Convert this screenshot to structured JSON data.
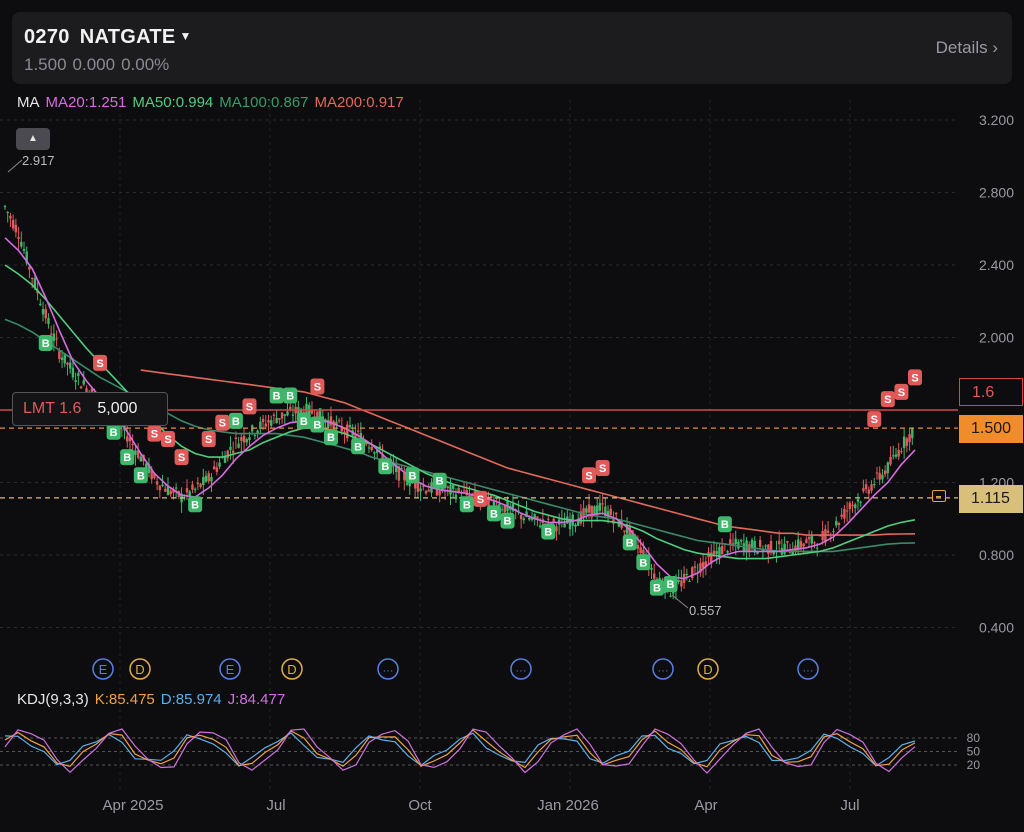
{
  "header": {
    "code": "0270",
    "name": "NATGATE",
    "price": "1.500",
    "change": "0.000",
    "change_pct": "0.00%",
    "details_label": "Details ›"
  },
  "ma_legend": {
    "title": "MA",
    "ma20": "MA20:1.251",
    "ma50": "MA50:0.994",
    "ma100": "MA100:0.867",
    "ma200": "MA200:0.917"
  },
  "kdj_legend": {
    "title": "KDJ(9,3,3)",
    "k": "K:85.475",
    "d": "D:85.974",
    "j": "J:84.477"
  },
  "y_axis_ticks": [
    "3.200",
    "2.800",
    "2.400",
    "2.000",
    "1.200",
    "0.800",
    "0.400"
  ],
  "x_axis_ticks": [
    "Apr 2025",
    "Jul",
    "Oct",
    "Jan 2026",
    "Apr",
    "Jul"
  ],
  "kdj_levels": [
    "80",
    "50",
    "20"
  ],
  "order_line": {
    "type": "LMT 1.6",
    "qty": "5,000",
    "price_tag": "1.6"
  },
  "last_price_tag": "1.500",
  "prev_price_tag": "1.115",
  "high_label": "2.917",
  "low_label": "0.557",
  "event_markers": [
    "E",
    "D",
    "E",
    "D",
    "···",
    "···",
    "···",
    "D",
    "···"
  ],
  "signal_labels": {
    "buy": "B",
    "sell": "S"
  },
  "colors": {
    "bg": "#0d0d0f",
    "up": "#3fb76b",
    "down": "#e05a5a",
    "ma20": "#d96be0",
    "ma50": "#4fcf7f",
    "ma100": "#3a8a6a",
    "ma200": "#e06a5a",
    "kdj_k": "#f0a040",
    "kdj_d": "#5ab0e8",
    "kdj_j": "#d070e0",
    "earnings": "#5a7fe0",
    "dividend": "#e0b040"
  },
  "chart_data": {
    "type": "candlestick",
    "ylim": [
      0.3,
      3.2
    ],
    "close": [
      2.72,
      2.58,
      2.34,
      2.12,
      1.92,
      1.81,
      1.72,
      1.66,
      1.58,
      1.46,
      1.34,
      1.22,
      1.16,
      1.12,
      1.16,
      1.22,
      1.33,
      1.42,
      1.47,
      1.52,
      1.56,
      1.58,
      1.6,
      1.58,
      1.53,
      1.49,
      1.46,
      1.41,
      1.33,
      1.25,
      1.2,
      1.17,
      1.16,
      1.15,
      1.13,
      1.11,
      1.09,
      1.06,
      1.02,
      0.99,
      0.97,
      0.97,
      0.99,
      1.04,
      1.06,
      1.0,
      0.92,
      0.81,
      0.67,
      0.6,
      0.66,
      0.73,
      0.79,
      0.84,
      0.86,
      0.85,
      0.84,
      0.84,
      0.84,
      0.87,
      0.88,
      0.95,
      1.05,
      1.12,
      1.2,
      1.28,
      1.4,
      1.5
    ],
    "ma20": [
      2.55,
      2.48,
      2.38,
      2.22,
      2.04,
      1.87,
      1.76,
      1.67,
      1.59,
      1.48,
      1.36,
      1.25,
      1.18,
      1.13,
      1.12,
      1.17,
      1.24,
      1.33,
      1.4,
      1.46,
      1.5,
      1.53,
      1.54,
      1.55,
      1.53,
      1.5,
      1.46,
      1.41,
      1.34,
      1.28,
      1.22,
      1.18,
      1.16,
      1.15,
      1.14,
      1.12,
      1.1,
      1.07,
      1.03,
      1.0,
      0.98,
      0.98,
      0.99,
      1.02,
      1.03,
      1.0,
      0.94,
      0.85,
      0.75,
      0.68,
      0.67,
      0.7,
      0.76,
      0.8,
      0.82,
      0.82,
      0.82,
      0.82,
      0.83,
      0.84,
      0.86,
      0.9,
      0.97,
      1.05,
      1.13,
      1.2,
      1.3,
      1.38
    ],
    "ma50": [
      2.4,
      2.35,
      2.29,
      2.21,
      2.12,
      2.03,
      1.94,
      1.86,
      1.78,
      1.7,
      1.62,
      1.54,
      1.46,
      1.4,
      1.36,
      1.34,
      1.34,
      1.36,
      1.38,
      1.42,
      1.45,
      1.48,
      1.5,
      1.5,
      1.49,
      1.47,
      1.44,
      1.41,
      1.37,
      1.33,
      1.29,
      1.25,
      1.22,
      1.19,
      1.17,
      1.15,
      1.13,
      1.1,
      1.07,
      1.04,
      1.02,
      1.0,
      0.99,
      0.99,
      0.99,
      0.98,
      0.96,
      0.93,
      0.89,
      0.86,
      0.83,
      0.81,
      0.8,
      0.79,
      0.78,
      0.78,
      0.78,
      0.79,
      0.8,
      0.81,
      0.82,
      0.84,
      0.87,
      0.9,
      0.93,
      0.96,
      0.98,
      0.994
    ],
    "ma100": [
      2.1,
      2.07,
      2.03,
      1.98,
      1.93,
      1.88,
      1.83,
      1.78,
      1.74,
      1.7,
      1.66,
      1.62,
      1.58,
      1.54,
      1.51,
      1.49,
      1.48,
      1.47,
      1.47,
      1.47,
      1.47,
      1.46,
      1.45,
      1.43,
      1.41,
      1.39,
      1.37,
      1.34,
      1.32,
      1.3,
      1.28,
      1.26,
      1.24,
      1.22,
      1.2,
      1.18,
      1.16,
      1.14,
      1.12,
      1.1,
      1.08,
      1.06,
      1.04,
      1.02,
      1.01,
      1.0,
      0.98,
      0.96,
      0.94,
      0.92,
      0.9,
      0.88,
      0.87,
      0.86,
      0.85,
      0.84,
      0.83,
      0.82,
      0.82,
      0.82,
      0.82,
      0.82,
      0.83,
      0.84,
      0.85,
      0.86,
      0.865,
      0.867
    ],
    "ma200": [
      null,
      null,
      null,
      null,
      null,
      null,
      null,
      null,
      null,
      null,
      1.82,
      1.81,
      1.8,
      1.79,
      1.78,
      1.77,
      1.76,
      1.75,
      1.74,
      1.73,
      1.72,
      1.71,
      1.7,
      1.68,
      1.66,
      1.64,
      1.61,
      1.58,
      1.55,
      1.52,
      1.49,
      1.46,
      1.43,
      1.4,
      1.37,
      1.34,
      1.31,
      1.28,
      1.26,
      1.24,
      1.22,
      1.2,
      1.18,
      1.16,
      1.14,
      1.12,
      1.1,
      1.08,
      1.06,
      1.04,
      1.02,
      1.0,
      0.98,
      0.96,
      0.95,
      0.94,
      0.93,
      0.92,
      0.92,
      0.91,
      0.91,
      0.91,
      0.91,
      0.91,
      0.91,
      0.915,
      0.916,
      0.917
    ],
    "order_price": 1.6,
    "last_price": 1.5,
    "prev_close": 1.115
  }
}
